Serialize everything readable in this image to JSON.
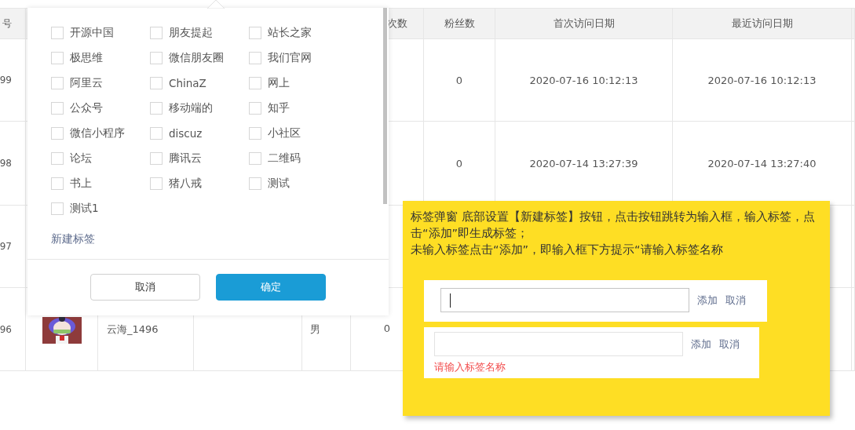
{
  "table": {
    "header": {
      "id": "号",
      "visits": "次数",
      "fans": "粉丝数",
      "first_visit": "首次访问日期",
      "last_visit": "最近访问日期"
    },
    "rows": [
      {
        "id": "99",
        "fans": "0",
        "first_visit": "2020-07-16 10:12:13",
        "last_visit": "2020-07-16 10:12:13"
      },
      {
        "id": "98",
        "fans": "0",
        "first_visit": "2020-07-14 13:27:39",
        "last_visit": "2020-07-14 13:27:40"
      },
      {
        "id": "97"
      },
      {
        "id": "96",
        "name": "云海_1496",
        "gender": "男",
        "visits": "0"
      }
    ]
  },
  "tag_popup": {
    "tags": [
      {
        "label": "开源中国",
        "checked": false
      },
      {
        "label": "朋友提起",
        "checked": false
      },
      {
        "label": "站长之家",
        "checked": false
      },
      {
        "label": "极思维",
        "checked": false
      },
      {
        "label": "微信朋友圈",
        "checked": false
      },
      {
        "label": "我们官网",
        "checked": false
      },
      {
        "label": "阿里云",
        "checked": false
      },
      {
        "label": "ChinaZ",
        "checked": false
      },
      {
        "label": "网上",
        "checked": false
      },
      {
        "label": "公众号",
        "checked": false
      },
      {
        "label": "移动端的",
        "checked": false
      },
      {
        "label": "知乎",
        "checked": false
      },
      {
        "label": "微信小程序",
        "checked": false
      },
      {
        "label": "discuz",
        "checked": false
      },
      {
        "label": "小社区",
        "checked": false
      },
      {
        "label": "论坛",
        "checked": false
      },
      {
        "label": "腾讯云",
        "checked": false
      },
      {
        "label": "二维码",
        "checked": false
      },
      {
        "label": "书上",
        "checked": false
      },
      {
        "label": "猪八戒",
        "checked": false
      },
      {
        "label": "测试",
        "checked": false
      },
      {
        "label": "测试1",
        "checked": false
      }
    ],
    "new_tag_link": "新建标签",
    "buttons": [
      {
        "label": "取消",
        "kind": "secondary"
      },
      {
        "label": "确定",
        "kind": "primary"
      }
    ]
  },
  "note": {
    "paragraphs": [
      "标签弹窗 底部设置【新建标签】按钮，点击按钮跳转为输入框，输入标签，点击“添加”即生成标签；",
      "未输入标签点击“添加”，即输入框下方提示“请输入标签名称"
    ],
    "mockups": [
      {
        "focused": true,
        "actions": [
          "添加",
          "取消"
        ]
      },
      {
        "focused": false,
        "actions": [
          "添加",
          "取消"
        ],
        "error": "请输入标签名称"
      }
    ]
  }
}
